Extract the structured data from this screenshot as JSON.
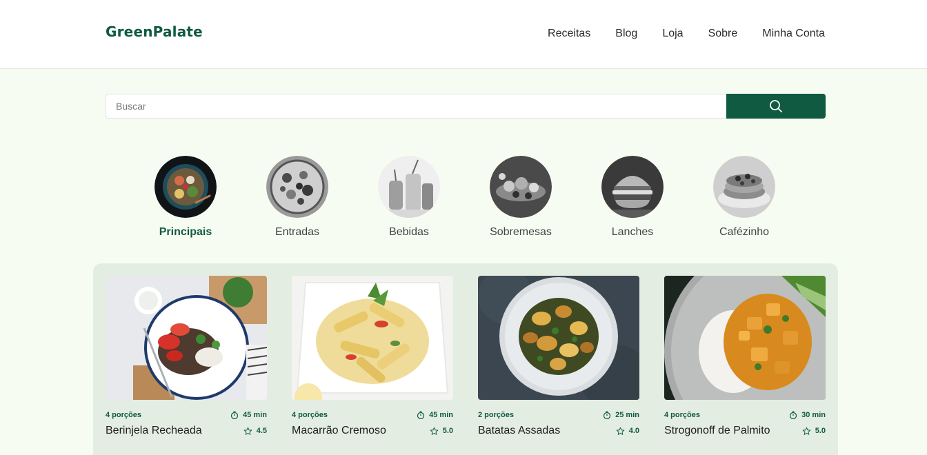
{
  "header": {
    "logo": "GreenPalate",
    "nav": [
      "Receitas",
      "Blog",
      "Loja",
      "Sobre",
      "Minha Conta"
    ]
  },
  "search": {
    "placeholder": "Buscar",
    "button_icon": "search-icon"
  },
  "categories": [
    {
      "label": "Principais",
      "active": true
    },
    {
      "label": "Entradas",
      "active": false
    },
    {
      "label": "Bebidas",
      "active": false
    },
    {
      "label": "Sobremesas",
      "active": false
    },
    {
      "label": "Lanches",
      "active": false
    },
    {
      "label": "Cafézinho",
      "active": false
    }
  ],
  "recipes": [
    {
      "servings": "4 porções",
      "time": "45 min",
      "title": "Berinjela Recheada",
      "rating": "4.5"
    },
    {
      "servings": "4 porções",
      "time": "45 min",
      "title": "Macarrão Cremoso",
      "rating": "5.0"
    },
    {
      "servings": "2 porções",
      "time": "25 min",
      "title": "Batatas Assadas",
      "rating": "4.0"
    },
    {
      "servings": "4 porções",
      "time": "30 min",
      "title": "Strogonoff de Palmito",
      "rating": "5.0"
    }
  ],
  "colors": {
    "brand": "#0f5a40",
    "background": "#f7fcf3",
    "panel": "#e4ede2"
  }
}
